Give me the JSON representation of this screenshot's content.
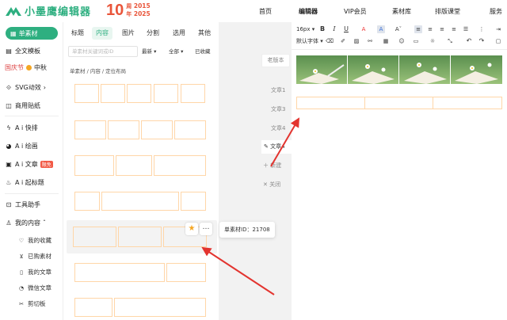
{
  "brand": {
    "name": "小墨鹰编辑器",
    "anniv_number": "10",
    "anniv_char": "周年",
    "years": [
      "2015",
      "2025"
    ],
    "brand_color": "#2eaf80"
  },
  "nav": [
    "首页",
    "编辑器",
    "VIP会员",
    "素材库",
    "排版课堂",
    "服务"
  ],
  "sidebar": {
    "active": "单素材",
    "items": [
      {
        "label": "全文模板",
        "icon": "document-icon"
      },
      {
        "label": "国庆节",
        "extra": "中秋",
        "icon": "festival-icon"
      },
      {
        "label": "SVG动效",
        "icon": "svg-icon"
      },
      {
        "label": "商用贴纸",
        "icon": "sticker-icon"
      },
      {
        "label": "A i 快排",
        "icon": "bolt-icon"
      },
      {
        "label": "A i 绘画",
        "icon": "palette-icon"
      },
      {
        "label": "A i 文章",
        "badge": "限免",
        "icon": "ai-article-icon"
      },
      {
        "label": "A i 起标题",
        "icon": "flame-icon"
      },
      {
        "label": "工具助手",
        "icon": "tool-icon"
      },
      {
        "label": "我的内容",
        "icon": "user-icon"
      }
    ],
    "subitems": [
      {
        "label": "我的收藏",
        "icon": "heart-icon"
      },
      {
        "label": "已购素材",
        "icon": "cart-icon"
      },
      {
        "label": "我的文章",
        "icon": "file-icon"
      },
      {
        "label": "微信文章",
        "icon": "wechat-icon"
      },
      {
        "label": "剪切板",
        "icon": "scissors-icon"
      }
    ]
  },
  "panel": {
    "tabs": [
      "标题",
      "内容",
      "图片",
      "分割",
      "选用",
      "其他"
    ],
    "active_tab": "内容",
    "search_placeholder": "单素材关键词或ID",
    "filters": [
      "最新",
      "全部",
      "已收藏"
    ],
    "breadcrumb": "单素材 / 内容 / 定位布局",
    "tooltip": "单素材ID：21708"
  },
  "work": {
    "old_version": "老版本",
    "tabs": [
      "文章1",
      "文章3",
      "文章4",
      "文章4",
      "新建",
      "关闭"
    ]
  },
  "editor": {
    "font_size": "16px",
    "default_font": "默认字体"
  }
}
